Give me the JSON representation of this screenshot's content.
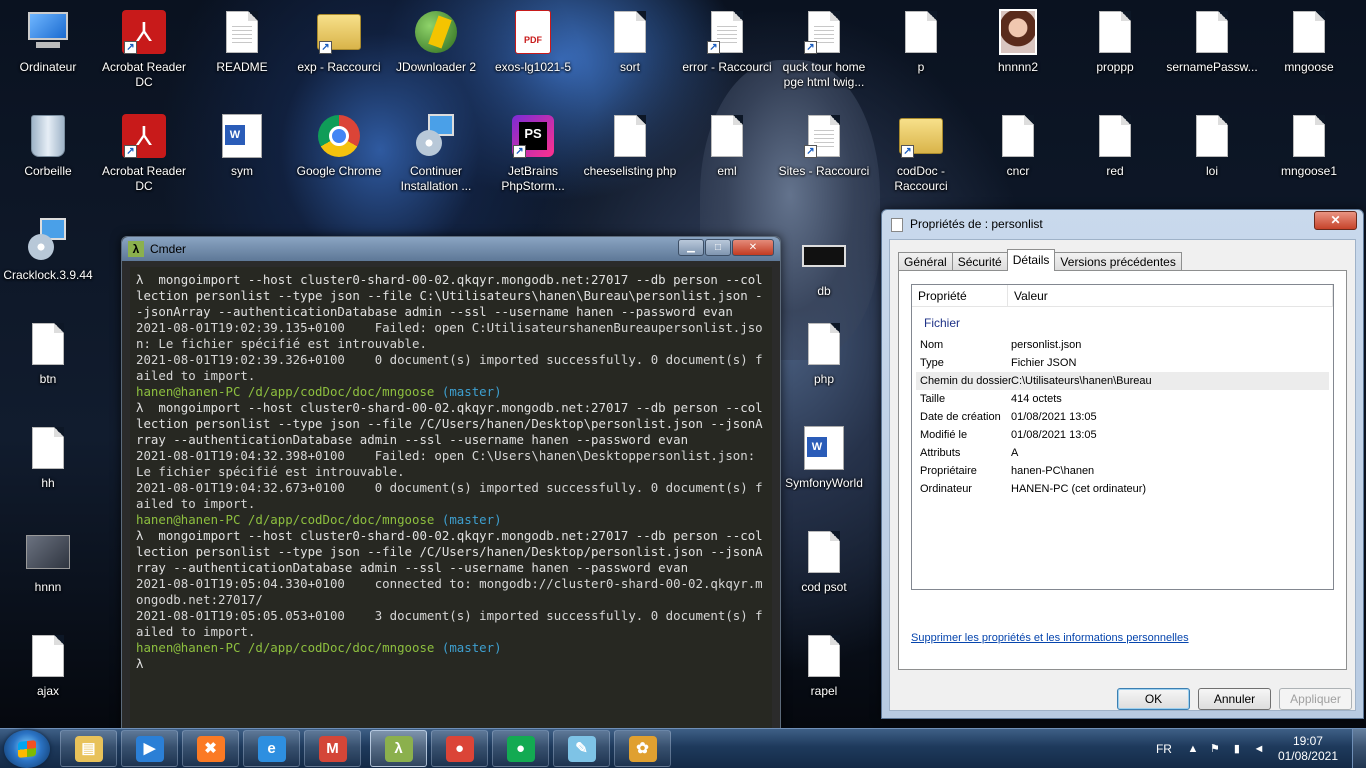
{
  "desktop": {
    "icons": [
      {
        "label": "Ordinateur",
        "icon": "computer-icon"
      },
      {
        "label": "Acrobat Reader DC",
        "icon": "acrobat-icon"
      },
      {
        "label": "README",
        "icon": "text-file-icon"
      },
      {
        "label": "exp - Raccourci",
        "icon": "folder-shortcut-icon"
      },
      {
        "label": "JDownloader 2",
        "icon": "jdownloader-icon"
      },
      {
        "label": "exos-lg1021-5",
        "icon": "pdf-file-icon"
      },
      {
        "label": "sort",
        "icon": "file-icon"
      },
      {
        "label": "error - Raccourci",
        "icon": "file-shortcut-icon"
      },
      {
        "label": "quck tour home pge html twig...",
        "icon": "file-shortcut-icon"
      },
      {
        "label": "p",
        "icon": "file-icon"
      },
      {
        "label": "hnnnn2",
        "icon": "image-file-icon"
      },
      {
        "label": "proppp",
        "icon": "file-icon"
      },
      {
        "label": "sernamePassw...",
        "icon": "file-icon"
      },
      {
        "label": "mngoose",
        "icon": "file-icon"
      },
      {
        "label": "Corbeille",
        "icon": "recycle-bin-icon"
      },
      {
        "label": "Acrobat Reader DC",
        "icon": "acrobat-icon"
      },
      {
        "label": "sym",
        "icon": "word-file-icon"
      },
      {
        "label": "Google Chrome",
        "icon": "chrome-icon"
      },
      {
        "label": "Continuer Installation ...",
        "icon": "installer-icon"
      },
      {
        "label": "JetBrains PhpStorm...",
        "icon": "phpstorm-icon"
      },
      {
        "label": "cheeselisting php",
        "icon": "file-icon"
      },
      {
        "label": "eml",
        "icon": "file-icon"
      },
      {
        "label": "Sites - Raccourci",
        "icon": "file-shortcut-icon"
      },
      {
        "label": "codDoc - Raccourci",
        "icon": "folder-shortcut-icon"
      },
      {
        "label": "cncr",
        "icon": "file-icon"
      },
      {
        "label": "red",
        "icon": "file-icon"
      },
      {
        "label": "loi",
        "icon": "file-icon"
      },
      {
        "label": "mngoose1",
        "icon": "file-icon"
      },
      {
        "label": "Cracklock.3.9.44",
        "icon": "installer-icon"
      },
      {
        "label": "db",
        "icon": "db-file-icon"
      },
      {
        "label": "btn",
        "icon": "file-icon"
      },
      {
        "label": "php",
        "icon": "file-icon"
      },
      {
        "label": "hh",
        "icon": "file-icon"
      },
      {
        "label": "SymfonyWorld",
        "icon": "word-file-icon"
      },
      {
        "label": "hnnn",
        "icon": "image-file-icon"
      },
      {
        "label": "cod psot",
        "icon": "file-icon"
      },
      {
        "label": "ajax",
        "icon": "file-icon"
      },
      {
        "label": "rapel",
        "icon": "file-icon"
      }
    ]
  },
  "cmder": {
    "title": "Cmder",
    "lines": [
      {
        "type": "cmd",
        "text": "λ  mongoimport --host cluster0-shard-00-02.qkqyr.mongodb.net:27017 --db person --collection personlist --type json --file C:\\Utilisateurs\\hanen\\Bureau\\personlist.json --jsonArray --authenticationDatabase admin --ssl --username hanen --password evan"
      },
      {
        "type": "out",
        "text": "2021-08-01T19:02:39.135+0100    Failed: open C:UtilisateurshanenBureaupersonlist.json: Le fichier spécifié est introuvable."
      },
      {
        "type": "out",
        "text": "2021-08-01T19:02:39.326+0100    0 document(s) imported successfully. 0 document(s) failed to import."
      },
      {
        "type": "prompt",
        "user": "hanen@hanen-PC",
        "path": " /d/app/codDoc/doc/mngoose",
        "branch": " (master)"
      },
      {
        "type": "cmd",
        "text": "λ  mongoimport --host cluster0-shard-00-02.qkqyr.mongodb.net:27017 --db person --collection personlist --type json --file /C/Users/hanen/Desktop\\personlist.json --jsonArray --authenticationDatabase admin --ssl --username hanen --password evan"
      },
      {
        "type": "out",
        "text": "2021-08-01T19:04:32.398+0100    Failed: open C:\\Users\\hanen\\Desktoppersonlist.json: Le fichier spécifié est introuvable."
      },
      {
        "type": "out",
        "text": "2021-08-01T19:04:32.673+0100    0 document(s) imported successfully. 0 document(s) failed to import."
      },
      {
        "type": "prompt",
        "user": "hanen@hanen-PC",
        "path": " /d/app/codDoc/doc/mngoose",
        "branch": " (master)"
      },
      {
        "type": "cmd",
        "text": "λ  mongoimport --host cluster0-shard-00-02.qkqyr.mongodb.net:27017 --db person --collection personlist --type json --file /C/Users/hanen/Desktop/personlist.json --jsonArray --authenticationDatabase admin --ssl --username hanen --password evan"
      },
      {
        "type": "out",
        "text": "2021-08-01T19:05:04.330+0100    connected to: mongodb://cluster0-shard-00-02.qkqyr.mongodb.net:27017/"
      },
      {
        "type": "out",
        "text": "2021-08-01T19:05:05.053+0100    3 document(s) imported successfully. 0 document(s) failed to import."
      },
      {
        "type": "prompt",
        "user": "hanen@hanen-PC",
        "path": " /d/app/codDoc/doc/mngoose",
        "branch": " (master)"
      },
      {
        "type": "cmd",
        "text": "λ"
      }
    ]
  },
  "properties": {
    "title": "Propriétés de : personlist",
    "close_label": "✕",
    "tabs": [
      "Général",
      "Sécurité",
      "Détails",
      "Versions précédentes"
    ],
    "active_tab": "Détails",
    "columns": [
      "Propriété",
      "Valeur"
    ],
    "group": "Fichier",
    "rows": [
      {
        "key": "Nom",
        "value": "personlist.json"
      },
      {
        "key": "Type",
        "value": "Fichier JSON"
      },
      {
        "key": "Chemin du dossier",
        "value": "C:\\Utilisateurs\\hanen\\Bureau"
      },
      {
        "key": "Taille",
        "value": "414 octets"
      },
      {
        "key": "Date de création",
        "value": "01/08/2021 13:05"
      },
      {
        "key": "Modifié le",
        "value": "01/08/2021 13:05"
      },
      {
        "key": "Attributs",
        "value": "A"
      },
      {
        "key": "Propriétaire",
        "value": "hanen-PC\\hanen"
      },
      {
        "key": "Ordinateur",
        "value": "HANEN-PC (cet ordinateur)"
      }
    ],
    "remove_link": "Supprimer les propriétés et les informations personnelles",
    "ok_label": "OK",
    "cancel_label": "Annuler",
    "apply_label": "Appliquer"
  },
  "taskbar": {
    "language": "FR",
    "time": "19:07",
    "date": "01/08/2021",
    "apps": [
      {
        "name": "explorer",
        "glyph": "▤",
        "color": "#e8c25a"
      },
      {
        "name": "media-player",
        "glyph": "▶",
        "color": "#2b7fd6"
      },
      {
        "name": "xampp",
        "glyph": "✖",
        "color": "#fb7a24"
      },
      {
        "name": "internet-explorer",
        "glyph": "e",
        "color": "#2e8fe0"
      },
      {
        "name": "gmail",
        "glyph": "M",
        "color": "#d44638"
      },
      {
        "name": "cmder",
        "glyph": "λ",
        "color": "#8bb04d"
      },
      {
        "name": "chrome",
        "glyph": "●",
        "color": "#db4437"
      },
      {
        "name": "mongodb-compass",
        "glyph": "●",
        "color": "#13aa52"
      },
      {
        "name": "notepad",
        "glyph": "✎",
        "color": "#7ec3e6"
      },
      {
        "name": "paint",
        "glyph": "✿",
        "color": "#e0a030"
      }
    ]
  }
}
